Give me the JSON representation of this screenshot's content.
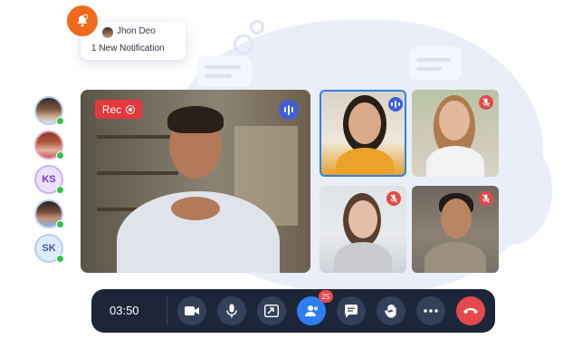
{
  "notification": {
    "sender": "Jhon Deo",
    "text": "1 New Notification",
    "icon": "bell-icon"
  },
  "participants_sidebar": [
    {
      "type": "photo",
      "status": "online"
    },
    {
      "type": "photo",
      "status": "online"
    },
    {
      "type": "initials",
      "initials": "KS",
      "status": "online"
    },
    {
      "type": "photo",
      "status": "online"
    },
    {
      "type": "initials",
      "initials": "SK",
      "status": "online"
    }
  ],
  "main_video": {
    "recording_label": "Rec",
    "speaking_icon": "audio-wave-icon"
  },
  "tiles": [
    {
      "speaking": true,
      "muted": false
    },
    {
      "speaking": false,
      "muted": true
    },
    {
      "speaking": false,
      "muted": true
    },
    {
      "speaking": false,
      "muted": true
    }
  ],
  "controls": {
    "timer": "03:50",
    "participants_count": "25",
    "buttons": [
      "camera-icon",
      "microphone-icon",
      "share-screen-icon",
      "participants-icon",
      "chat-icon",
      "raise-hand-icon",
      "more-icon",
      "end-call-icon"
    ]
  },
  "colors": {
    "accent": "#2f7ef0",
    "bar": "#1c2638",
    "record": "#e5373e",
    "online": "#33c24d",
    "notification": "#f06a1e"
  }
}
